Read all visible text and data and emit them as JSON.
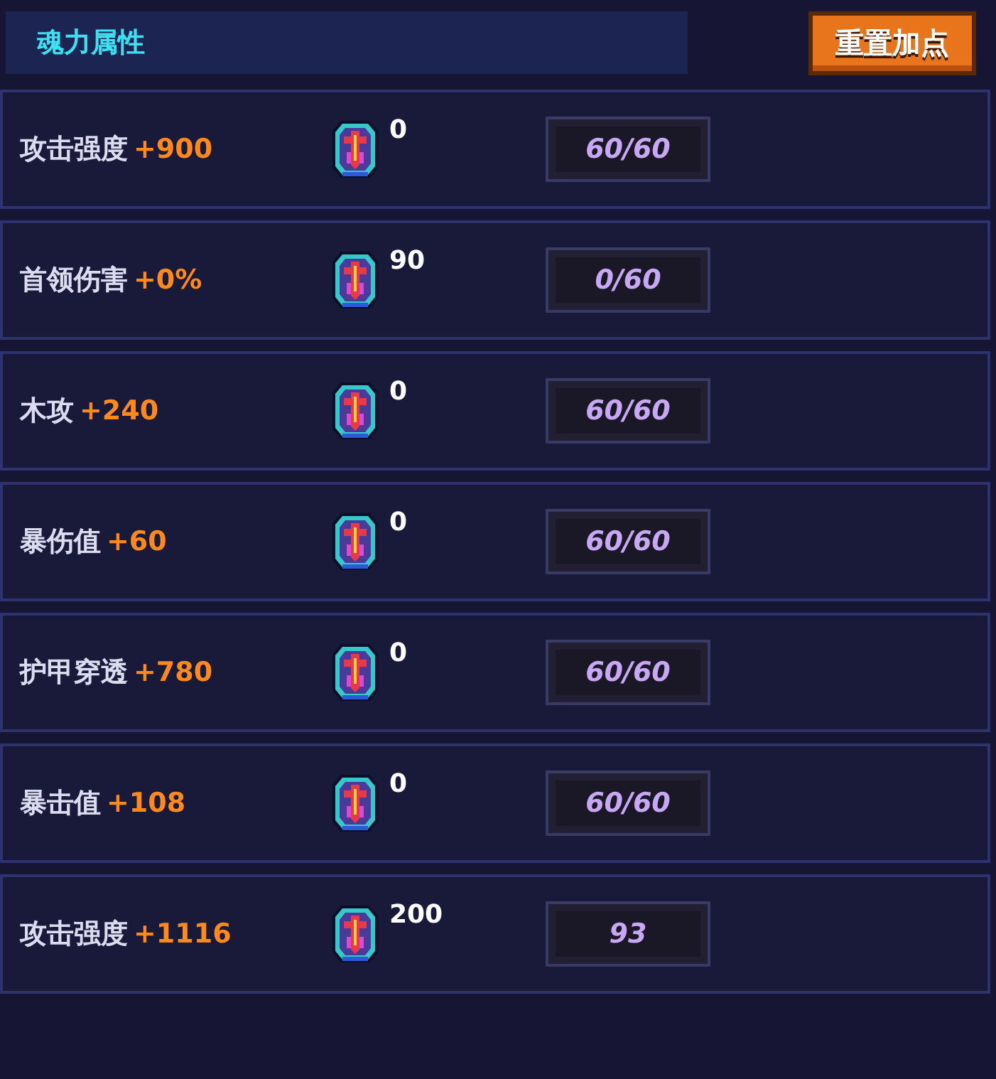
{
  "header": {
    "title": "魂力属性",
    "reset_button": "重置加点"
  },
  "rows": [
    {
      "name": "攻击强度",
      "bonus": "+900",
      "cost": "0",
      "progress": "60/60"
    },
    {
      "name": "首领伤害",
      "bonus": "+0%",
      "cost": "90",
      "progress": "0/60"
    },
    {
      "name": "木攻",
      "bonus": "+240",
      "cost": "0",
      "progress": "60/60"
    },
    {
      "name": "暴伤值",
      "bonus": "+60",
      "cost": "0",
      "progress": "60/60"
    },
    {
      "name": "护甲穿透",
      "bonus": "+780",
      "cost": "0",
      "progress": "60/60"
    },
    {
      "name": "暴击值",
      "bonus": "+108",
      "cost": "0",
      "progress": "60/60"
    },
    {
      "name": "攻击强度",
      "bonus": "+1116",
      "cost": "200",
      "progress": "93"
    }
  ]
}
